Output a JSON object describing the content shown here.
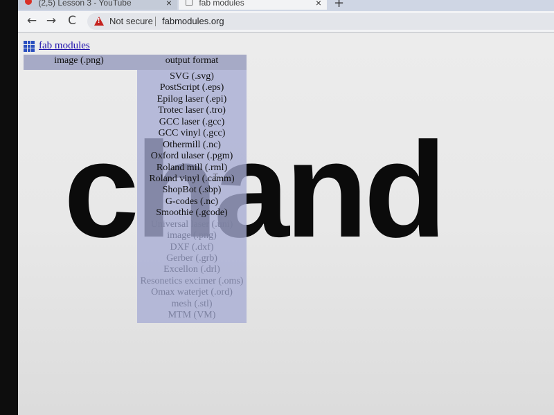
{
  "browser": {
    "tabs": [
      {
        "label": "(2,5) Lesson 3 - YouTube"
      },
      {
        "label": "fab modules"
      }
    ],
    "new_tab_label": "+",
    "close_label": "×",
    "security_label": "Not secure",
    "url": "fabmodules.org",
    "nav": {
      "back": "←",
      "forward": "→",
      "reload": "C"
    }
  },
  "page": {
    "site_link": "fab modules",
    "input_format": "image (.png)",
    "output_format_header": "output format",
    "big_text": "chand",
    "output_formats": [
      {
        "label": "SVG (.svg)",
        "enabled": true
      },
      {
        "label": "PostScript (.eps)",
        "enabled": true
      },
      {
        "label": "Epilog laser (.epi)",
        "enabled": true
      },
      {
        "label": "Trotec laser (.tro)",
        "enabled": true
      },
      {
        "label": "GCC laser (.gcc)",
        "enabled": true
      },
      {
        "label": "GCC vinyl (.gcc)",
        "enabled": true
      },
      {
        "label": "Othermill (.nc)",
        "enabled": true
      },
      {
        "label": "Oxford ulaser (.pgm)",
        "enabled": true
      },
      {
        "label": "Roland mill (.rml)",
        "enabled": true
      },
      {
        "label": "Roland vinyl (.camm)",
        "enabled": true
      },
      {
        "label": "ShopBot (.sbp)",
        "enabled": true
      },
      {
        "label": "G-codes (.nc)",
        "enabled": true
      },
      {
        "label": "Smoothie (.gcode)",
        "enabled": true
      },
      {
        "label": "Universal laser (.uni)",
        "enabled": false
      },
      {
        "label": "image (.png)",
        "enabled": false
      },
      {
        "label": "DXF (.dxf)",
        "enabled": false
      },
      {
        "label": "Gerber (.grb)",
        "enabled": false
      },
      {
        "label": "Excellon (.drl)",
        "enabled": false
      },
      {
        "label": "Resonetics excimer (.oms)",
        "enabled": false
      },
      {
        "label": "Omax waterjet (.ord)",
        "enabled": false
      },
      {
        "label": "mesh (.stl)",
        "enabled": false
      },
      {
        "label": "MTM (VM)",
        "enabled": false
      }
    ]
  },
  "colors": {
    "menu_bg": "#a6acd4",
    "link": "#1a0dab",
    "warning": "#c5221f"
  }
}
